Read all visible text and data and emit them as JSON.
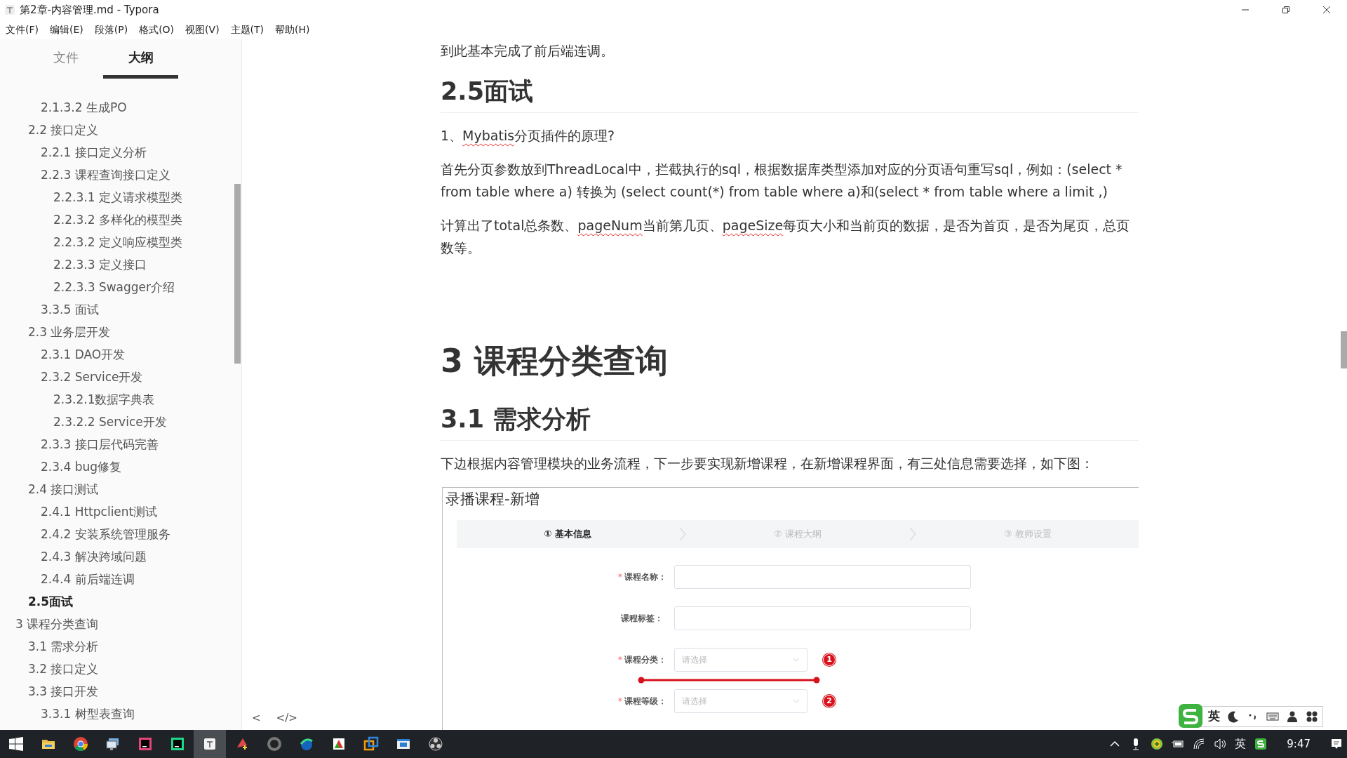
{
  "window": {
    "title": "第2章-内容管理.md - Typora"
  },
  "menu": [
    "文件(F)",
    "编辑(E)",
    "段落(P)",
    "格式(O)",
    "视图(V)",
    "主题(T)",
    "帮助(H)"
  ],
  "sidebar": {
    "tabs": [
      {
        "label": "文件",
        "selected": false
      },
      {
        "label": "大纲",
        "selected": true
      }
    ],
    "outline": [
      {
        "children": [
          {
            "children": [
              {
                "label": "2.1.3.2 生成PO",
                "selected": false
              }
            ]
          },
          {
            "label": "2.2 接口定义",
            "selected": false,
            "children": [
              {
                "label": "2.2.1 接口定义分析",
                "selected": false
              },
              {
                "label": "2.2.3 课程查询接口定义",
                "selected": false,
                "children": [
                  {
                    "label": "2.2.3.1 定义请求模型类",
                    "selected": false
                  },
                  {
                    "label": "2.2.3.2 多样化的模型类",
                    "selected": false
                  },
                  {
                    "label": "2.2.3.2 定义响应模型类",
                    "selected": false
                  },
                  {
                    "label": "2.2.3.3 定义接口",
                    "selected": false
                  },
                  {
                    "label": "2.2.3.3 Swagger介绍",
                    "selected": false
                  }
                ]
              },
              {
                "label": "3.3.5 面试",
                "selected": false
              }
            ]
          },
          {
            "label": "2.3 业务层开发",
            "selected": false,
            "children": [
              {
                "label": "2.3.1 DAO开发",
                "selected": false
              },
              {
                "label": "2.3.2 Service开发",
                "selected": false,
                "children": [
                  {
                    "label": "2.3.2.1数据字典表",
                    "selected": false
                  },
                  {
                    "label": "2.3.2.2 Service开发",
                    "selected": false
                  }
                ]
              },
              {
                "label": "2.3.3 接口层代码完善",
                "selected": false
              },
              {
                "label": "2.3.4 bug修复",
                "selected": false
              }
            ]
          },
          {
            "label": "2.4 接口测试",
            "selected": false,
            "children": [
              {
                "label": "2.4.1 Httpclient测试",
                "selected": false
              },
              {
                "label": "2.4.2 安装系统管理服务",
                "selected": false
              },
              {
                "label": "2.4.3 解决跨域问题",
                "selected": false
              },
              {
                "label": "2.4.4 前后端连调",
                "selected": false
              }
            ]
          },
          {
            "label": "2.5面试",
            "selected": true
          }
        ]
      },
      {
        "label": "3 课程分类查询",
        "selected": false,
        "children": [
          {
            "label": "3.1 需求分析",
            "selected": false
          },
          {
            "label": "3.2 接口定义",
            "selected": false
          },
          {
            "label": "3.3 接口开发",
            "selected": false,
            "children": [
              {
                "label": "3.3.1 树型表查询",
                "selected": false
              }
            ]
          }
        ]
      }
    ]
  },
  "footer_buttons": [
    "<",
    "</>"
  ],
  "document": [
    {
      "kind": "p",
      "parts": [
        {
          "text": "到此基本完成了前后端连调。",
          "misspelled": false
        }
      ]
    },
    {
      "kind": "h2",
      "text": "2.5面试"
    },
    {
      "kind": "p",
      "parts": [
        {
          "text": "1、",
          "misspelled": false
        },
        {
          "text": "Mybatis",
          "misspelled": true
        },
        {
          "text": "分页插件的原理?",
          "misspelled": false
        }
      ]
    },
    {
      "kind": "p",
      "parts": [
        {
          "text": "首先分页参数放到ThreadLocal中，拦截执行的sql，根据数据库类型添加对应的分页语句重写sql，例如：(select * from table where a) 转换为 (select count(*) from table where a)和(select * from table where a limit ,)",
          "misspelled": false
        }
      ]
    },
    {
      "kind": "p",
      "parts": [
        {
          "text": "计算出了total总条数、",
          "misspelled": false
        },
        {
          "text": "pageNum",
          "misspelled": true
        },
        {
          "text": "当前第几页、",
          "misspelled": false
        },
        {
          "text": "pageSize",
          "misspelled": true
        },
        {
          "text": "每页大小和当前页的数据，是否为首页，是否为尾页，总页数等。",
          "misspelled": false
        }
      ]
    },
    {
      "kind": "h1",
      "text": "3 课程分类查询"
    },
    {
      "kind": "h2",
      "text": "3.1 需求分析"
    },
    {
      "kind": "p",
      "parts": [
        {
          "text": "下边根据内容管理模块的业务流程，下一步要实现新增课程，在新增课程界面，有三处信息需要选择，如下图：",
          "misspelled": false
        }
      ]
    },
    {
      "kind": "figure",
      "title": "录播课程-新增",
      "steps": [
        {
          "icon": "①",
          "label": "基本信息",
          "active": true
        },
        {
          "icon": "②",
          "label": "课程大纲",
          "active": false
        },
        {
          "icon": "③",
          "label": "教师设置",
          "active": false
        }
      ],
      "fields": [
        {
          "kind": "text",
          "required_mark": "*",
          "label": "课程名称：",
          "underlined": false
        },
        {
          "kind": "text",
          "label": "课程标签：",
          "underlined": false
        },
        {
          "kind": "select",
          "required_mark": "*",
          "label": "课程分类：",
          "placeholder": "请选择",
          "marker": "1",
          "underlined": true
        },
        {
          "kind": "select",
          "required_mark": "*",
          "label": "课程等级：",
          "placeholder": "请选择",
          "marker": "2",
          "underlined": false
        }
      ]
    }
  ],
  "taskbar": {
    "apps": [
      {
        "kind": "folder",
        "active": false
      },
      {
        "kind": "chrome",
        "active": false
      },
      {
        "kind": "monitor",
        "active": false
      },
      {
        "kind": "ij",
        "active": false
      },
      {
        "kind": "dg",
        "active": false
      },
      {
        "kind": "typora",
        "active": true
      },
      {
        "kind": "pen",
        "active": false
      },
      {
        "kind": "ring",
        "active": false
      },
      {
        "kind": "wave",
        "active": false
      },
      {
        "kind": "slides",
        "active": false
      },
      {
        "kind": "squares",
        "active": false
      },
      {
        "kind": "window",
        "active": false
      },
      {
        "kind": "obs",
        "active": false
      }
    ],
    "tray": {
      "language": "英",
      "time": "9:47"
    }
  },
  "ime_bar": {
    "language": "英"
  }
}
